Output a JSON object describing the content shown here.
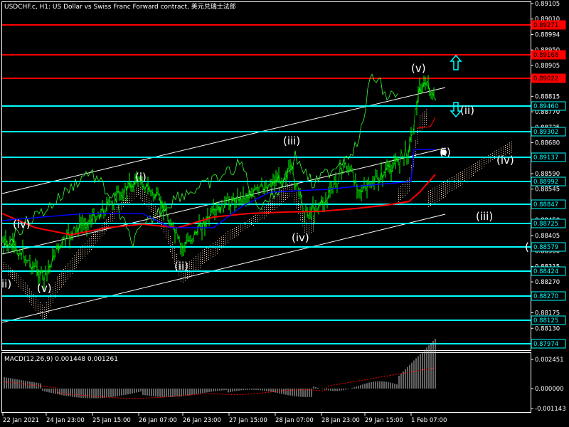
{
  "window": {
    "title": "USDCHF.c, H1:  US Dollar vs Swiss Franc Forward contract, 美元兑瑞士法郎",
    "colors": {
      "background": "#000000",
      "candles": "#00ff00",
      "support": "#00ffff",
      "resistance": "#ff0000",
      "channel": "#ffffff",
      "ma": "#ff0000",
      "ma2": "#0000ff",
      "cloud": "#ffdab9"
    }
  },
  "chart_data": {
    "type": "line",
    "price_axis": {
      "range": [
        0.879,
        0.89105
      ],
      "ticks": [
        "0.89105",
        "0.89010",
        "0.88994",
        "0.88950",
        "0.88905",
        "0.88860",
        "0.88815",
        "0.88770",
        "0.88725",
        "0.88680",
        "0.88635",
        "0.88590",
        "0.88545",
        "0.88500",
        "0.88450",
        "0.88405",
        "0.88360",
        "0.88315",
        "0.88270",
        "0.88220",
        "0.88175",
        "0.88130",
        "0.88075"
      ]
    },
    "time_axis": {
      "labels": [
        "22 Jan 2021",
        "24 Jan 23:00",
        "25 Jan 15:00",
        "26 Jan 07:00",
        "26 Jan 23:00",
        "27 Jan 15:00",
        "28 Jan 07:00",
        "28 Jan 23:00",
        "29 Jan 15:00",
        "1 Feb 07:00"
      ]
    },
    "horizontal_levels": [
      {
        "value": "0.89271",
        "color": "#ff0000"
      },
      {
        "value": "0.89168",
        "color": "#ff0000"
      },
      {
        "value": "0.89022",
        "color": "#ff0000"
      },
      {
        "value": "0.89460",
        "color": "#00ffff"
      },
      {
        "value": "0.89302",
        "color": "#00ffff"
      },
      {
        "value": "0.89137",
        "color": "#00ffff"
      },
      {
        "value": "0.88992",
        "color": "#00ffff"
      },
      {
        "value": "0.88847",
        "color": "#00ffff"
      },
      {
        "value": "0.88725",
        "color": "#00ffff"
      },
      {
        "value": "0.88579",
        "color": "#00ffff"
      },
      {
        "value": "0.88424",
        "color": "#00ffff"
      },
      {
        "value": "0.88270",
        "color": "#00ffff"
      },
      {
        "value": "0.88125",
        "color": "#00ffff"
      },
      {
        "value": "0.87974",
        "color": "#00ffff"
      }
    ],
    "wave_labels": [
      "ii)",
      "(iv)",
      "(v)",
      "(i)",
      "(ii)",
      "(iii)",
      "(iv)",
      "(v)",
      "(ii)",
      "(i)",
      "(iv)",
      "(iii)",
      "("
    ],
    "macd": {
      "label": "MACD(12,26,9) 0.001448 0.001261",
      "axis_ticks": [
        "0.002451",
        "0.000000",
        "-0.001143"
      ]
    }
  }
}
